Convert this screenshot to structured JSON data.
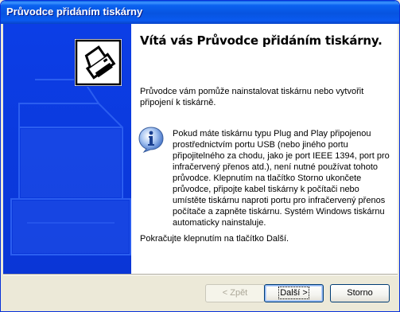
{
  "window": {
    "title": "Průvodce přidáním tiskárny"
  },
  "icons": {
    "wizard": "printer-wizard-icon",
    "info": "info-icon"
  },
  "colors": {
    "side_panel": "#0a36d6",
    "titlebar": "#0754e0",
    "content_bg": "#ffffff",
    "dialog_bg": "#ece9d8"
  },
  "content": {
    "heading": "Vítá vás Průvodce přidáním tiskárny.",
    "intro": "Průvodce vám pomůže nainstalovat tiskárnu nebo vytvořit připojení k tiskárně.",
    "info": "Pokud máte tiskárnu typu Plug and Play připojenou prostřednictvím portu USB (nebo jiného portu připojitelného za chodu, jako je port IEEE 1394, port pro infračervený přenos atd.), není nutné používat tohoto průvodce. Klepnutím na tlačítko Storno ukončete průvodce, připojte kabel tiskárny k počítači nebo umístěte tiskárnu naproti portu pro infračervený přenos počítače a zapněte tiskárnu. Systém Windows tiskárnu automaticky nainstaluje.",
    "closing": "Pokračujte klepnutím na tlačítko Další."
  },
  "buttons": {
    "back": "< Zpět",
    "next": "Další >",
    "cancel": "Storno"
  }
}
